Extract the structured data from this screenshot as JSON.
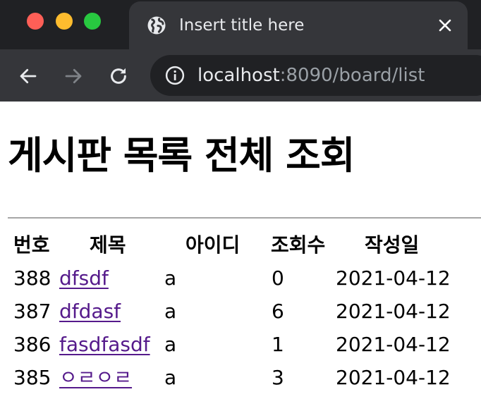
{
  "browser": {
    "tab": {
      "title": "Insert title here"
    },
    "address": {
      "host": "localhost",
      "path": ":8090/board/list"
    }
  },
  "page": {
    "heading": "게시판 목록 전체 조회",
    "table": {
      "headers": [
        "번호",
        "제목",
        "아이디",
        "조회수",
        "작성일"
      ],
      "rows": [
        {
          "no": "388",
          "title": "dfsdf",
          "author": "a",
          "views": "0",
          "date": "2021-04-12"
        },
        {
          "no": "387",
          "title": "dfdasf",
          "author": "a",
          "views": "6",
          "date": "2021-04-12"
        },
        {
          "no": "386",
          "title": "fasdfasdf",
          "author": "a",
          "views": "1",
          "date": "2021-04-12"
        },
        {
          "no": "385",
          "title": "ㅇㄹㅇㄹ",
          "author": "a",
          "views": "3",
          "date": "2021-04-12"
        }
      ]
    }
  },
  "colors": {
    "chrome_dark": "#202124",
    "chrome_tab": "#35363a",
    "link_visited": "#551a8b"
  }
}
